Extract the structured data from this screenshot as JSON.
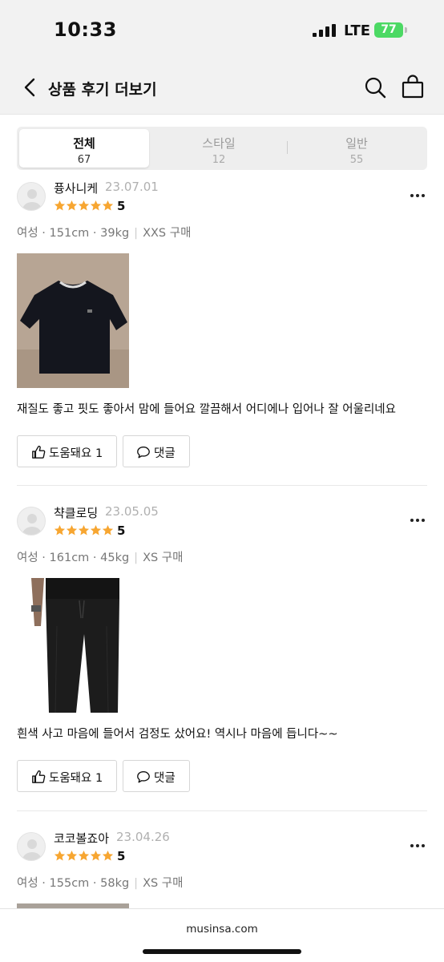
{
  "status_bar": {
    "time": "10:33",
    "network": "LTE",
    "battery": "77"
  },
  "header": {
    "title": "상품 후기 더보기"
  },
  "tabs": [
    {
      "label": "전체",
      "count": "67"
    },
    {
      "label": "스타일",
      "count": "12"
    },
    {
      "label": "일반",
      "count": "55"
    }
  ],
  "reviews": [
    {
      "name": "퓽사니케",
      "date": "23.07.01",
      "rating": "5",
      "meta_gender": "여성",
      "meta_body": "151cm · 39kg",
      "meta_purchase": "XXS 구매",
      "text": "재질도 좋고 핏도 좋아서 맘에 들어요 깔끔해서 어디에나 입어나 잘 어울리네요",
      "helpful_label": "도움돼요 1",
      "comment_label": "댓글"
    },
    {
      "name": "챡클로딩",
      "date": "23.05.05",
      "rating": "5",
      "meta_gender": "여성",
      "meta_body": "161cm · 45kg",
      "meta_purchase": "XS 구매",
      "text": "흰색 사고 마음에 들어서 검정도 샀어요! 역시나 마음에 듭니다~~",
      "helpful_label": "도움돼요 1",
      "comment_label": "댓글"
    },
    {
      "name": "코코볼죠아",
      "date": "23.04.26",
      "rating": "5",
      "meta_gender": "여성",
      "meta_body": "155cm · 58kg",
      "meta_purchase": "XS 구매"
    }
  ],
  "footer": {
    "url": "musinsa.com"
  },
  "colors": {
    "star": "#f7a631",
    "battery": "#4cd964",
    "header_bg": "#f2f2f2"
  },
  "icons": {
    "back": "chevron-left-icon",
    "search": "search-icon",
    "bag": "shopping-bag-icon",
    "more": "more-dots-icon",
    "thumbs": "thumbs-up-icon",
    "comment": "speech-bubble-icon"
  }
}
